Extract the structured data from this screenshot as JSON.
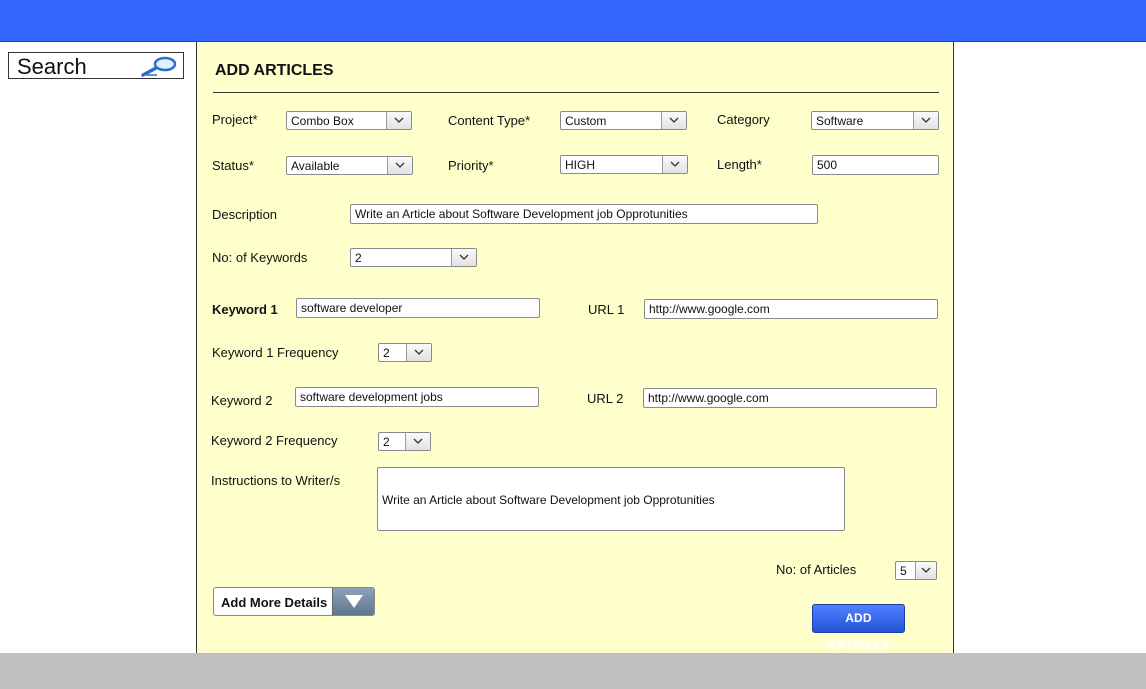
{
  "sidebar": {
    "search_label": "Search"
  },
  "form": {
    "title": "ADD ARTICLES",
    "project": {
      "label": "Project*",
      "value": "Combo Box"
    },
    "content_type": {
      "label": "Content Type*",
      "value": "Custom"
    },
    "category": {
      "label": "Category",
      "value": "Software"
    },
    "status": {
      "label": "Status*",
      "value": "Available"
    },
    "priority": {
      "label": "Priority*",
      "value": "HIGH"
    },
    "length": {
      "label": "Length*",
      "value": "500"
    },
    "description": {
      "label": "Description",
      "value": "Write an Article about Software Development job Opprotunities"
    },
    "num_keywords": {
      "label": "No: of Keywords",
      "value": "2"
    },
    "keywords": [
      {
        "label": "Keyword 1",
        "value": "software developer",
        "url_label": "URL 1",
        "url": "http://www.google.com",
        "freq_label": "Keyword 1 Frequency",
        "freq": "2"
      },
      {
        "label": "Keyword 2",
        "value": "software development jobs",
        "url_label": "URL 2",
        "url": "http://www.google.com",
        "freq_label": "Keyword 2 Frequency",
        "freq": "2"
      }
    ],
    "instructions": {
      "label": "Instructions to Writer/s",
      "value": "Write an Article about Software Development job Opprotunities"
    },
    "num_articles": {
      "label": "No: of Articles",
      "value": "5"
    },
    "more_details_label": "Add More Details",
    "add_button_label": "ADD ARTICLES"
  },
  "colors": {
    "header": "#3366ff",
    "panel": "#ffffcc",
    "footer": "#c0c0c0",
    "button": "#2f62e8"
  }
}
